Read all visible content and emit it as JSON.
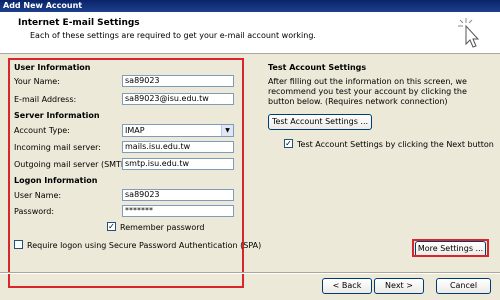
{
  "window": {
    "title": "Add New Account"
  },
  "header": {
    "title": "Internet E-mail Settings",
    "subtitle": "Each of these settings are required to get your e-mail account working."
  },
  "user_info": {
    "heading": "User Information",
    "name_label": "Your Name:",
    "name_value": "sa89023",
    "email_label": "E-mail Address:",
    "email_value": "sa89023@isu.edu.tw"
  },
  "server_info": {
    "heading": "Server Information",
    "type_label": "Account Type:",
    "type_value": "IMAP",
    "incoming_label": "Incoming mail server:",
    "incoming_value": "mails.isu.edu.tw",
    "outgoing_label": "Outgoing mail server (SMTP):",
    "outgoing_value": "smtp.isu.edu.tw"
  },
  "logon_info": {
    "heading": "Logon Information",
    "user_label": "User Name:",
    "user_value": "sa89023",
    "password_label": "Password:",
    "password_value": "*******",
    "remember_label": "Remember password",
    "remember_checked": true
  },
  "spa": {
    "label": "Require logon using Secure Password Authentication (SPA)",
    "checked": false
  },
  "test": {
    "heading": "Test Account Settings",
    "description": "After filling out the information on this screen, we recommend you test your account by clicking the button below. (Requires network connection)",
    "button_label": "Test Account Settings ...",
    "next_check_label": "Test Account Settings by clicking the Next button",
    "next_checked": true
  },
  "footer": {
    "more_settings": "More Settings ...",
    "back": "< Back",
    "next": "Next >",
    "cancel": "Cancel"
  },
  "colors": {
    "highlight_red": "#d8262c",
    "title_blue": "#0a246a"
  }
}
